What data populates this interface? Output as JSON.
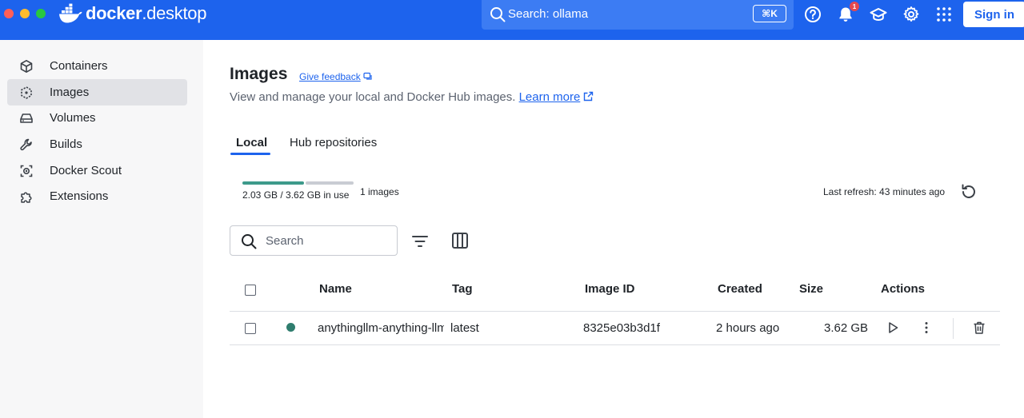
{
  "window": {
    "traffic_colors": [
      "#ff5f57",
      "#febc2e",
      "#28c840"
    ]
  },
  "topbar": {
    "logo_text_bold": "docker",
    "logo_text_light": ".desktop",
    "search_text": "Search: ollama",
    "shortcut": "⌘K",
    "notification_count": "1",
    "signin_label": "Sign in",
    "accent": "#1d63ed"
  },
  "sidebar": {
    "items": [
      {
        "label": "Containers",
        "icon": "cube-icon"
      },
      {
        "label": "Images",
        "icon": "image-layers-icon",
        "active": true
      },
      {
        "label": "Volumes",
        "icon": "hard-drive-icon"
      },
      {
        "label": "Builds",
        "icon": "wrench-icon"
      },
      {
        "label": "Docker Scout",
        "icon": "scout-icon"
      },
      {
        "label": "Extensions",
        "icon": "puzzle-icon"
      }
    ]
  },
  "main": {
    "title": "Images",
    "feedback_label": "Give feedback",
    "subtitle": "View and manage your local and Docker Hub images.",
    "learn_more": "Learn more",
    "tabs": [
      {
        "label": "Local",
        "active": true
      },
      {
        "label": "Hub repositories",
        "active": false
      }
    ],
    "usage": {
      "text": "2.03 GB / 3.62 GB in use",
      "fraction_used": 0.56,
      "image_count": "1 images"
    },
    "last_refresh": "Last refresh: 43 minutes ago",
    "search_placeholder": "Search",
    "table": {
      "columns": [
        "Name",
        "Tag",
        "Image ID",
        "Created",
        "Size",
        "Actions"
      ],
      "rows": [
        {
          "name": "anythingllm-anything-llm",
          "tag": "latest",
          "image_id": "8325e03b3d1f",
          "created": "2 hours ago",
          "size": "3.62 GB",
          "in_use": true
        }
      ]
    }
  }
}
